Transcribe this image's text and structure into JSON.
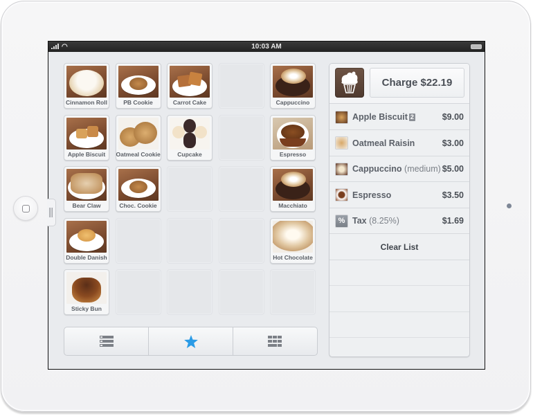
{
  "status_bar": {
    "time": "10:03 AM",
    "signal_icon": "signal-bars-icon",
    "wifi_icon": "wifi-icon",
    "battery_icon": "battery-icon"
  },
  "grid": {
    "items": [
      {
        "label": "Cinnamon Roll",
        "col": 0,
        "row": 0,
        "kind": "roll"
      },
      {
        "label": "PB Cookie",
        "col": 1,
        "row": 0,
        "kind": "cookie"
      },
      {
        "label": "Carrot Cake",
        "col": 2,
        "row": 0,
        "kind": "cake"
      },
      {
        "label": "Cappuccino",
        "col": 4,
        "row": 0,
        "kind": "coffee"
      },
      {
        "label": "Apple Biscuit",
        "col": 0,
        "row": 1,
        "kind": "biscuit"
      },
      {
        "label": "Oatmeal Cookie",
        "col": 1,
        "row": 1,
        "kind": "oatmeal"
      },
      {
        "label": "Cupcake",
        "col": 2,
        "row": 1,
        "kind": "cupcake"
      },
      {
        "label": "Espresso",
        "col": 4,
        "row": 1,
        "kind": "espresso"
      },
      {
        "label": "Bear Claw",
        "col": 0,
        "row": 2,
        "kind": "bearclaw"
      },
      {
        "label": "Choc. Cookie",
        "col": 1,
        "row": 2,
        "kind": "cookie"
      },
      {
        "label": "Macchiato",
        "col": 4,
        "row": 2,
        "kind": "coffee"
      },
      {
        "label": "Double Danish",
        "col": 0,
        "row": 3,
        "kind": "danish"
      },
      {
        "label": "Hot Chocolate",
        "col": 4,
        "row": 3,
        "kind": "latte"
      },
      {
        "label": "Sticky Bun",
        "col": 0,
        "row": 4,
        "kind": "stickybun"
      }
    ],
    "empty_slots": [
      [
        3,
        0
      ],
      [
        3,
        1
      ],
      [
        2,
        2
      ],
      [
        3,
        2
      ],
      [
        1,
        3
      ],
      [
        2,
        3
      ],
      [
        3,
        3
      ],
      [
        1,
        4
      ],
      [
        2,
        4
      ],
      [
        3,
        4
      ],
      [
        4,
        4
      ]
    ]
  },
  "toolbar": {
    "buttons": [
      {
        "name": "list-view",
        "icon": "list-icon",
        "selected": false
      },
      {
        "name": "favorites",
        "icon": "star-icon",
        "selected": true
      },
      {
        "name": "grid-view",
        "icon": "grid-icon",
        "selected": false
      }
    ],
    "accent_color": "#2a9be6"
  },
  "cart": {
    "logo_icon": "cupcake-icon",
    "charge_label": "Charge $22.19",
    "items": [
      {
        "name": "Apple Biscuit",
        "modifier": "",
        "qty": "2",
        "price": "$9.00",
        "kind": "biscuit"
      },
      {
        "name": "Oatmeal Raisin",
        "modifier": "",
        "qty": "",
        "price": "$3.00",
        "kind": "oatmeal"
      },
      {
        "name": "Cappuccino",
        "modifier": "(medium)",
        "qty": "",
        "price": "$5.00",
        "kind": "coffee"
      },
      {
        "name": "Espresso",
        "modifier": "",
        "qty": "",
        "price": "$3.50",
        "kind": "espresso"
      }
    ],
    "tax": {
      "name": "Tax",
      "rate": "(8.25%)",
      "price": "$1.69",
      "icon": "percent-icon",
      "icon_text": "%"
    },
    "clear_label": "Clear List"
  }
}
